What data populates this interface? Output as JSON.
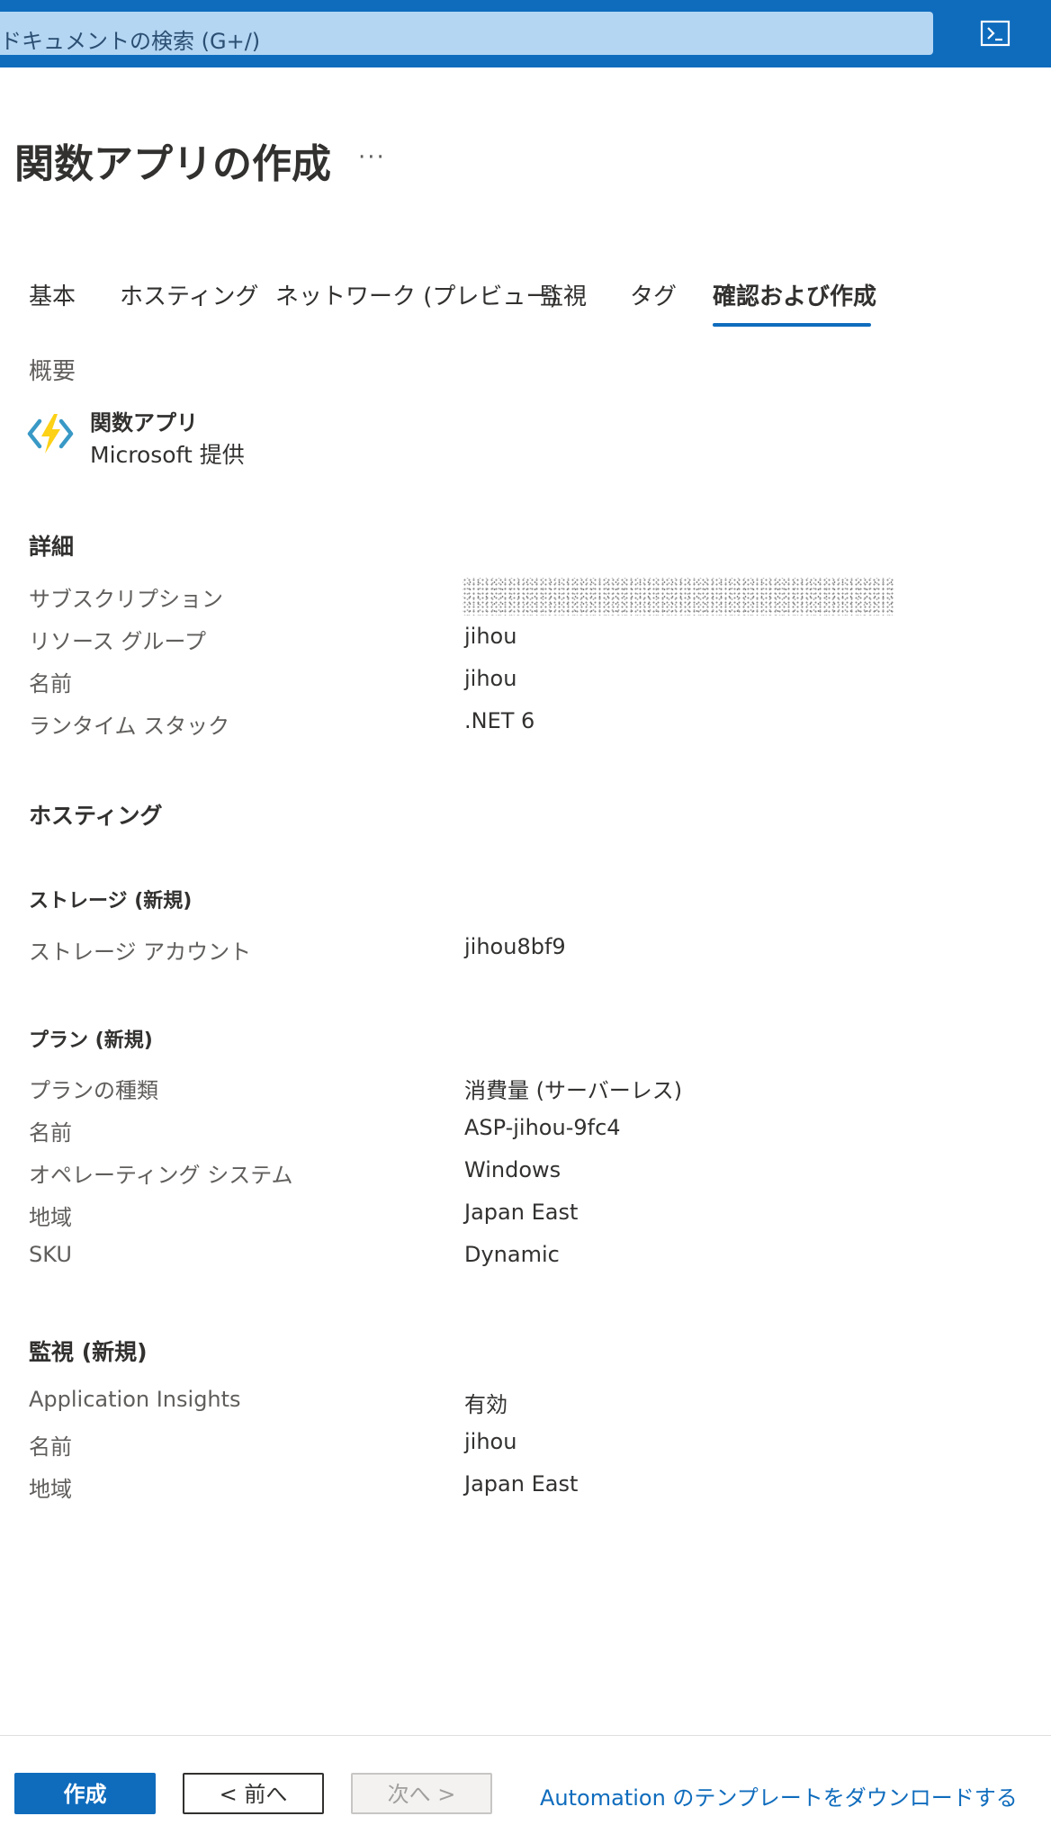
{
  "topbar": {
    "search_placeholder": "ドキュメントの検索 (G+/)",
    "terminal_icon": "cloud-shell-icon"
  },
  "header": {
    "title": "関数アプリの作成",
    "more_label": "···"
  },
  "tabs": [
    {
      "label": "基本",
      "active": false
    },
    {
      "label": "ホスティング",
      "active": false
    },
    {
      "label": "ネットワーク (プレビュー)",
      "active": false
    },
    {
      "label": "監視",
      "active": false
    },
    {
      "label": "タグ",
      "active": false
    },
    {
      "label": "確認および作成",
      "active": true
    }
  ],
  "overview": {
    "label": "概要",
    "product_name": "関数アプリ",
    "publisher": "Microsoft 提供",
    "icon": "function-app-icon"
  },
  "details": {
    "heading": "詳細",
    "rows": [
      {
        "label": "サブスクリプション",
        "value": ""
      },
      {
        "label": "リソース グループ",
        "value": "jihou"
      },
      {
        "label": "名前",
        "value": "jihou"
      },
      {
        "label": "ランタイム スタック",
        "value": ".NET 6"
      }
    ]
  },
  "hosting": {
    "heading": "ホスティング",
    "storage": {
      "heading": "ストレージ (新規)",
      "rows": [
        {
          "label": "ストレージ アカウント",
          "value": "jihou8bf9"
        }
      ]
    },
    "plan": {
      "heading": "プラン (新規)",
      "rows": [
        {
          "label": "プランの種類",
          "value": "消費量 (サーバーレス)"
        },
        {
          "label": "名前",
          "value": "ASP-jihou-9fc4"
        },
        {
          "label": "オペレーティング システム",
          "value": "Windows"
        },
        {
          "label": "地域",
          "value": "Japan East"
        },
        {
          "label": "SKU",
          "value": "Dynamic"
        }
      ]
    }
  },
  "monitoring": {
    "heading": "監視 (新規)",
    "rows": [
      {
        "label": "Application Insights",
        "value": "有効"
      },
      {
        "label": "名前",
        "value": "jihou"
      },
      {
        "label": "地域",
        "value": "Japan East"
      }
    ]
  },
  "footer": {
    "create_label": "作成",
    "prev_label": "< 前へ",
    "next_label": "次へ >",
    "download_link": "Automation のテンプレートをダウンロードする"
  },
  "colors": {
    "accent": "#0f6cbd",
    "search_bg": "#b4d6f3"
  }
}
